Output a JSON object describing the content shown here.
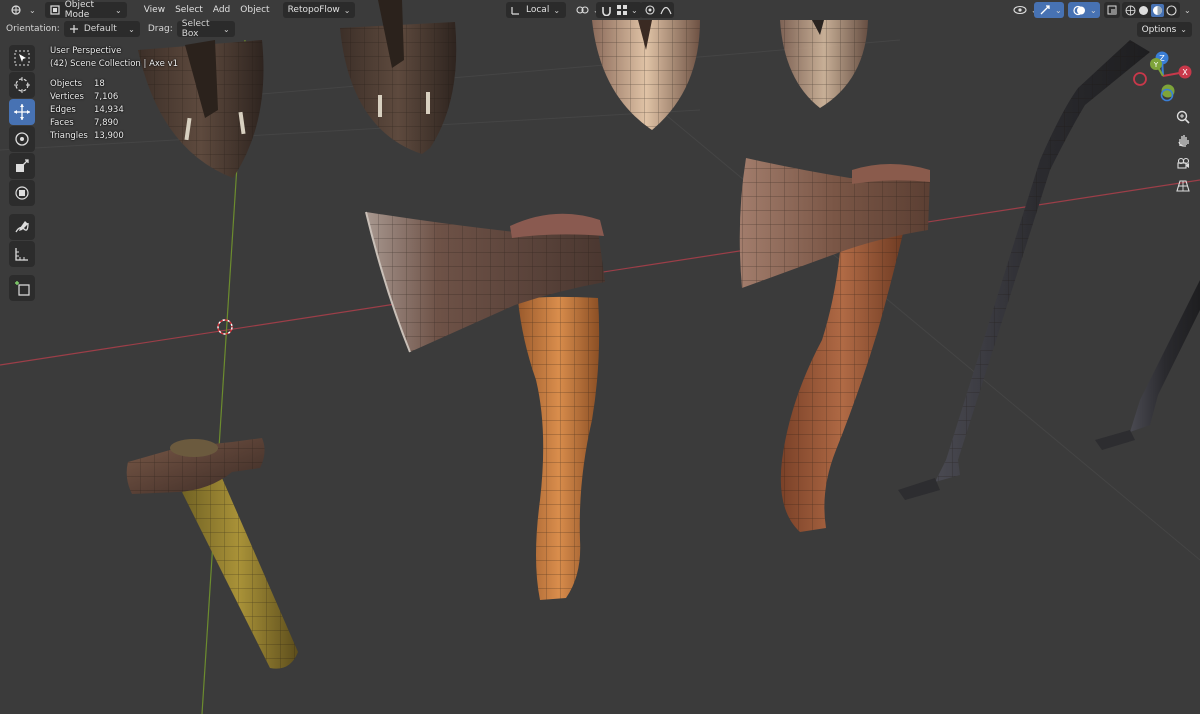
{
  "header": {
    "mode_label": "Object Mode",
    "menu": [
      "View",
      "Select",
      "Add",
      "Object"
    ],
    "addon_label": "RetopoFlow",
    "transform_space": "Local"
  },
  "tool_header": {
    "orientation_label": "Orientation:",
    "orientation_value": "Default",
    "drag_label": "Drag:",
    "drag_value": "Select Box",
    "options_label": "Options"
  },
  "overlay": {
    "perspective": "User Perspective",
    "collection": "(42) Scene Collection | Axe v1",
    "stats": [
      {
        "key": "Objects",
        "value": "18"
      },
      {
        "key": "Vertices",
        "value": "7,106"
      },
      {
        "key": "Edges",
        "value": "14,934"
      },
      {
        "key": "Faces",
        "value": "7,890"
      },
      {
        "key": "Triangles",
        "value": "13,900"
      }
    ]
  },
  "gizmo": {
    "x": "X",
    "y": "Y",
    "z": "Z"
  },
  "colors": {
    "active_tool": "#4772b3",
    "x_axis": "#c8384a",
    "y_axis": "#7ea43a",
    "z_axis": "#3a7ed6",
    "viewport_bg": "#3b3b3b"
  },
  "toolbar_icons": [
    "select-box-icon",
    "cursor-icon",
    "move-icon",
    "rotate-icon",
    "scale-icon",
    "transform-icon",
    "annotate-icon",
    "measure-icon",
    "add-cube-icon"
  ]
}
